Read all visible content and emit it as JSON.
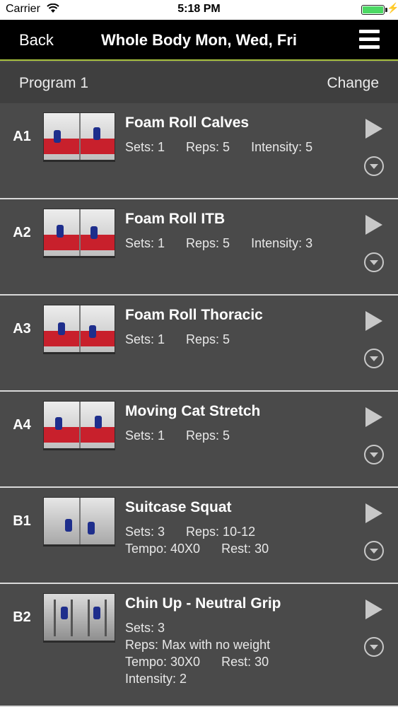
{
  "status_bar": {
    "carrier": "Carrier",
    "time": "5:18 PM",
    "battery_color": "#4cd964"
  },
  "nav": {
    "back_label": "Back",
    "title": "Whole Body Mon, Wed, Fri",
    "menu_icon": "hamburger-menu-icon",
    "accent_color": "#a9c23f"
  },
  "program": {
    "name": "Program 1",
    "change_label": "Change"
  },
  "exercises": [
    {
      "code": "A1",
      "name": "Foam Roll Calves",
      "lines": [
        "Sets: 1      Reps: 5      Intensity: 5"
      ]
    },
    {
      "code": "A2",
      "name": "Foam Roll ITB",
      "lines": [
        "Sets: 1      Reps: 5      Intensity: 3"
      ]
    },
    {
      "code": "A3",
      "name": "Foam Roll Thoracic",
      "lines": [
        "Sets: 1      Reps: 5"
      ]
    },
    {
      "code": "A4",
      "name": "Moving Cat Stretch",
      "lines": [
        "Sets: 1      Reps: 5"
      ]
    },
    {
      "code": "B1",
      "name": "Suitcase Squat",
      "lines": [
        "Sets: 3      Reps: 10-12",
        "Tempo: 40X0      Rest: 30"
      ]
    },
    {
      "code": "B2",
      "name": "Chin Up - Neutral Grip",
      "lines": [
        "Sets: 3",
        "Reps: Max with no weight",
        "Tempo: 30X0      Rest: 30",
        "Intensity: 2"
      ]
    }
  ],
  "icons": {
    "play": "play-icon",
    "expand": "chevron-down-circle-icon"
  }
}
